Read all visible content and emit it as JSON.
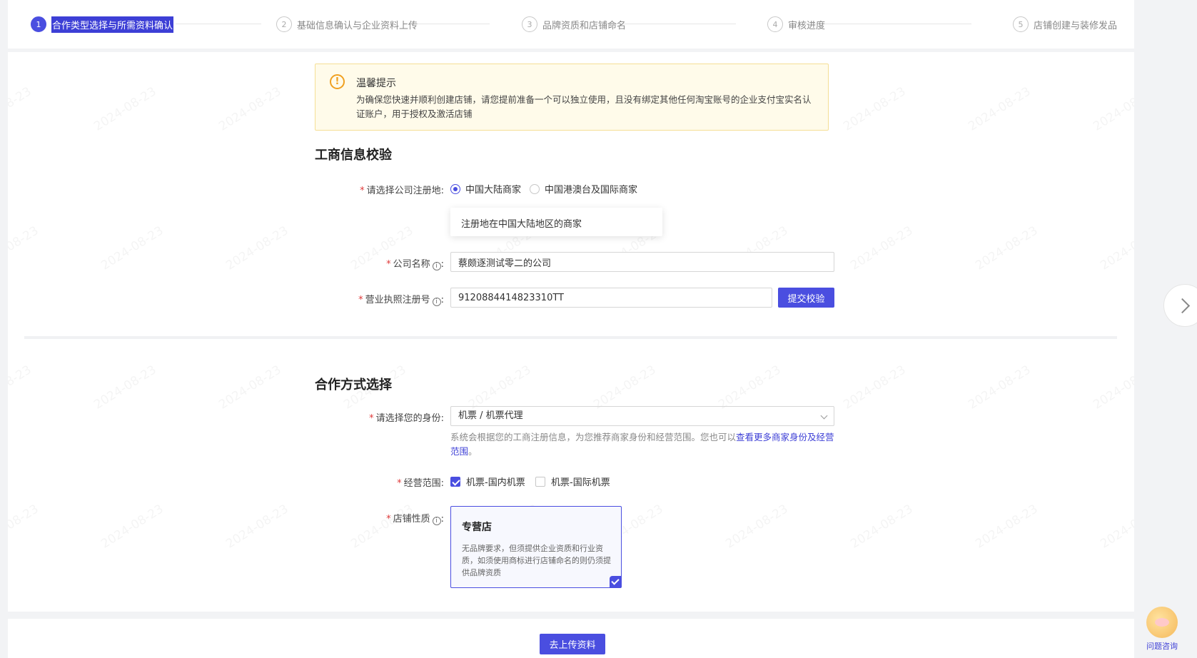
{
  "steps": [
    {
      "num": "1",
      "label": "合作类型选择与所需资料确认",
      "active": true
    },
    {
      "num": "2",
      "label": "基础信息确认与企业资料上传"
    },
    {
      "num": "3",
      "label": "品牌资质和店铺命名"
    },
    {
      "num": "4",
      "label": "审核进度"
    },
    {
      "num": "5",
      "label": "店铺创建与装修发品"
    }
  ],
  "notice": {
    "title": "温馨提示",
    "text": "为确保您快速并顺利创建店铺，请您提前准备一个可以独立使用，且没有绑定其他任何淘宝账号的企业支付宝实名认证账户，用于授权及激活店铺"
  },
  "watermark": "2024-08-23",
  "business": {
    "title": "工商信息校验",
    "region_label": "请选择公司注册地:",
    "region_options": [
      "中国大陆商家",
      "中国港澳台及国际商家"
    ],
    "region_tooltip": "注册地在中国大陆地区的商家",
    "company_label": "公司名称",
    "company_value": "蔡颇逐测试零二的公司",
    "license_label": "营业执照注册号",
    "license_value": "9120884414823310TT",
    "submit_label": "提交校验"
  },
  "cooperation": {
    "title": "合作方式选择",
    "identity_label": "请选择您的身份:",
    "identity_value": "机票 / 机票代理",
    "help_text": "系统会根据您的工商注册信息，为您推荐商家身份和经营范围。您也可以",
    "help_link": "查看更多商家身份及经营范围",
    "help_end": "。",
    "scope_label": "经营范围:",
    "scope_options": [
      {
        "label": "机票-国内机票",
        "checked": true
      },
      {
        "label": "机票-国际机票",
        "checked": false
      }
    ],
    "store_label": "店铺性质",
    "store_title": "专营店",
    "store_desc": "无品牌要求，但须提供企业资质和行业资质，如须使用商标进行店铺命名的则仍须提供品牌资质"
  },
  "footer": {
    "upload_label": "去上传资料"
  },
  "helper": {
    "label": "问题咨询"
  },
  "colors": {
    "primary": "#4a4ee0",
    "required": "#e03a3a",
    "notice_bg": "#fffbea"
  },
  "icons": {
    "notice": "warning-icon",
    "info": "info-icon",
    "next": "chevron-right-icon"
  }
}
